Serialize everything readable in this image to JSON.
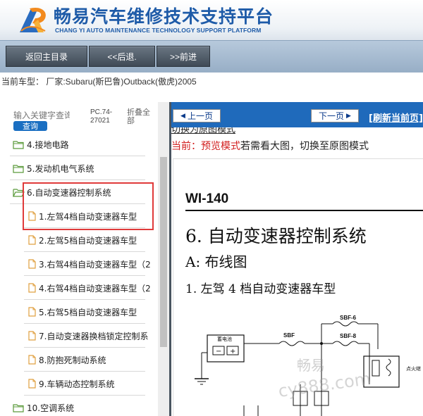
{
  "header": {
    "title_cn": "畅易汽车维修技术支持平台",
    "title_en": "CHANG YI AUTO MAINTENANCE TECHNOLOGY SUPPORT PLATFORM"
  },
  "nav": {
    "home": "返回主目录",
    "back": "<<后退.",
    "forward": ">>前进"
  },
  "model_line": "当前车型： 厂家:Subaru(斯巴鲁)Outback(傲虎)2005",
  "sidebar": {
    "search_placeholder": "输入关键字查询",
    "search_button": "查询",
    "pc_code": "PC.74-27021",
    "collapse": "折叠全部",
    "items": [
      {
        "label": "4.接地电路",
        "type": "folder",
        "level": 0
      },
      {
        "label": "5.发动机电气系统",
        "type": "folder",
        "level": 0
      },
      {
        "label": "6.自动变速器控制系统",
        "type": "folder-open",
        "level": 0
      },
      {
        "label": "1.左驾4档自动变速器车型",
        "type": "doc",
        "level": 1
      },
      {
        "label": "2.左驾5档自动变速器车型",
        "type": "doc",
        "level": 1
      },
      {
        "label": "3.右驾4档自动变速器车型（2",
        "type": "doc",
        "level": 1
      },
      {
        "label": "4.右驾4档自动变速器车型（2",
        "type": "doc",
        "level": 1
      },
      {
        "label": "5.右驾5档自动变速器车型",
        "type": "doc",
        "level": 1
      },
      {
        "label": "7.自动变速器换档锁定控制系",
        "type": "doc",
        "level": 1
      },
      {
        "label": "8.防抱死制动系统",
        "type": "doc",
        "level": 1
      },
      {
        "label": "9.车辆动态控制系统",
        "type": "doc",
        "level": 1
      },
      {
        "label": "10.空调系统",
        "type": "folder",
        "level": 0
      }
    ]
  },
  "viewer": {
    "prev": "上一页",
    "next": "下一页",
    "refresh": "[刷新当前页]",
    "mode_link": "切换为原图模式",
    "mode_prefix": "当前：预览模式",
    "mode_suffix": "若需看大图，切换至原图模式"
  },
  "document": {
    "code": "WI-140",
    "heading1": "6.  自动变速器控制系统",
    "heading2": "A:  布线图",
    "heading3": "1.  左驾 4 档自动变速器车型",
    "labels": {
      "battery": "蓄电池",
      "sbf": "SBF",
      "sbf6": "SBF-6",
      "sbf8": "SBF-8",
      "ignition": "点火继"
    },
    "watermark_cn": "畅易",
    "watermark_url": "cy888.com"
  },
  "colors": {
    "brand_blue": "#1e5ba8",
    "highlight_red": "#e03a3a",
    "pager_blue": "#1f6abb",
    "mode_red": "#d21f1f"
  }
}
